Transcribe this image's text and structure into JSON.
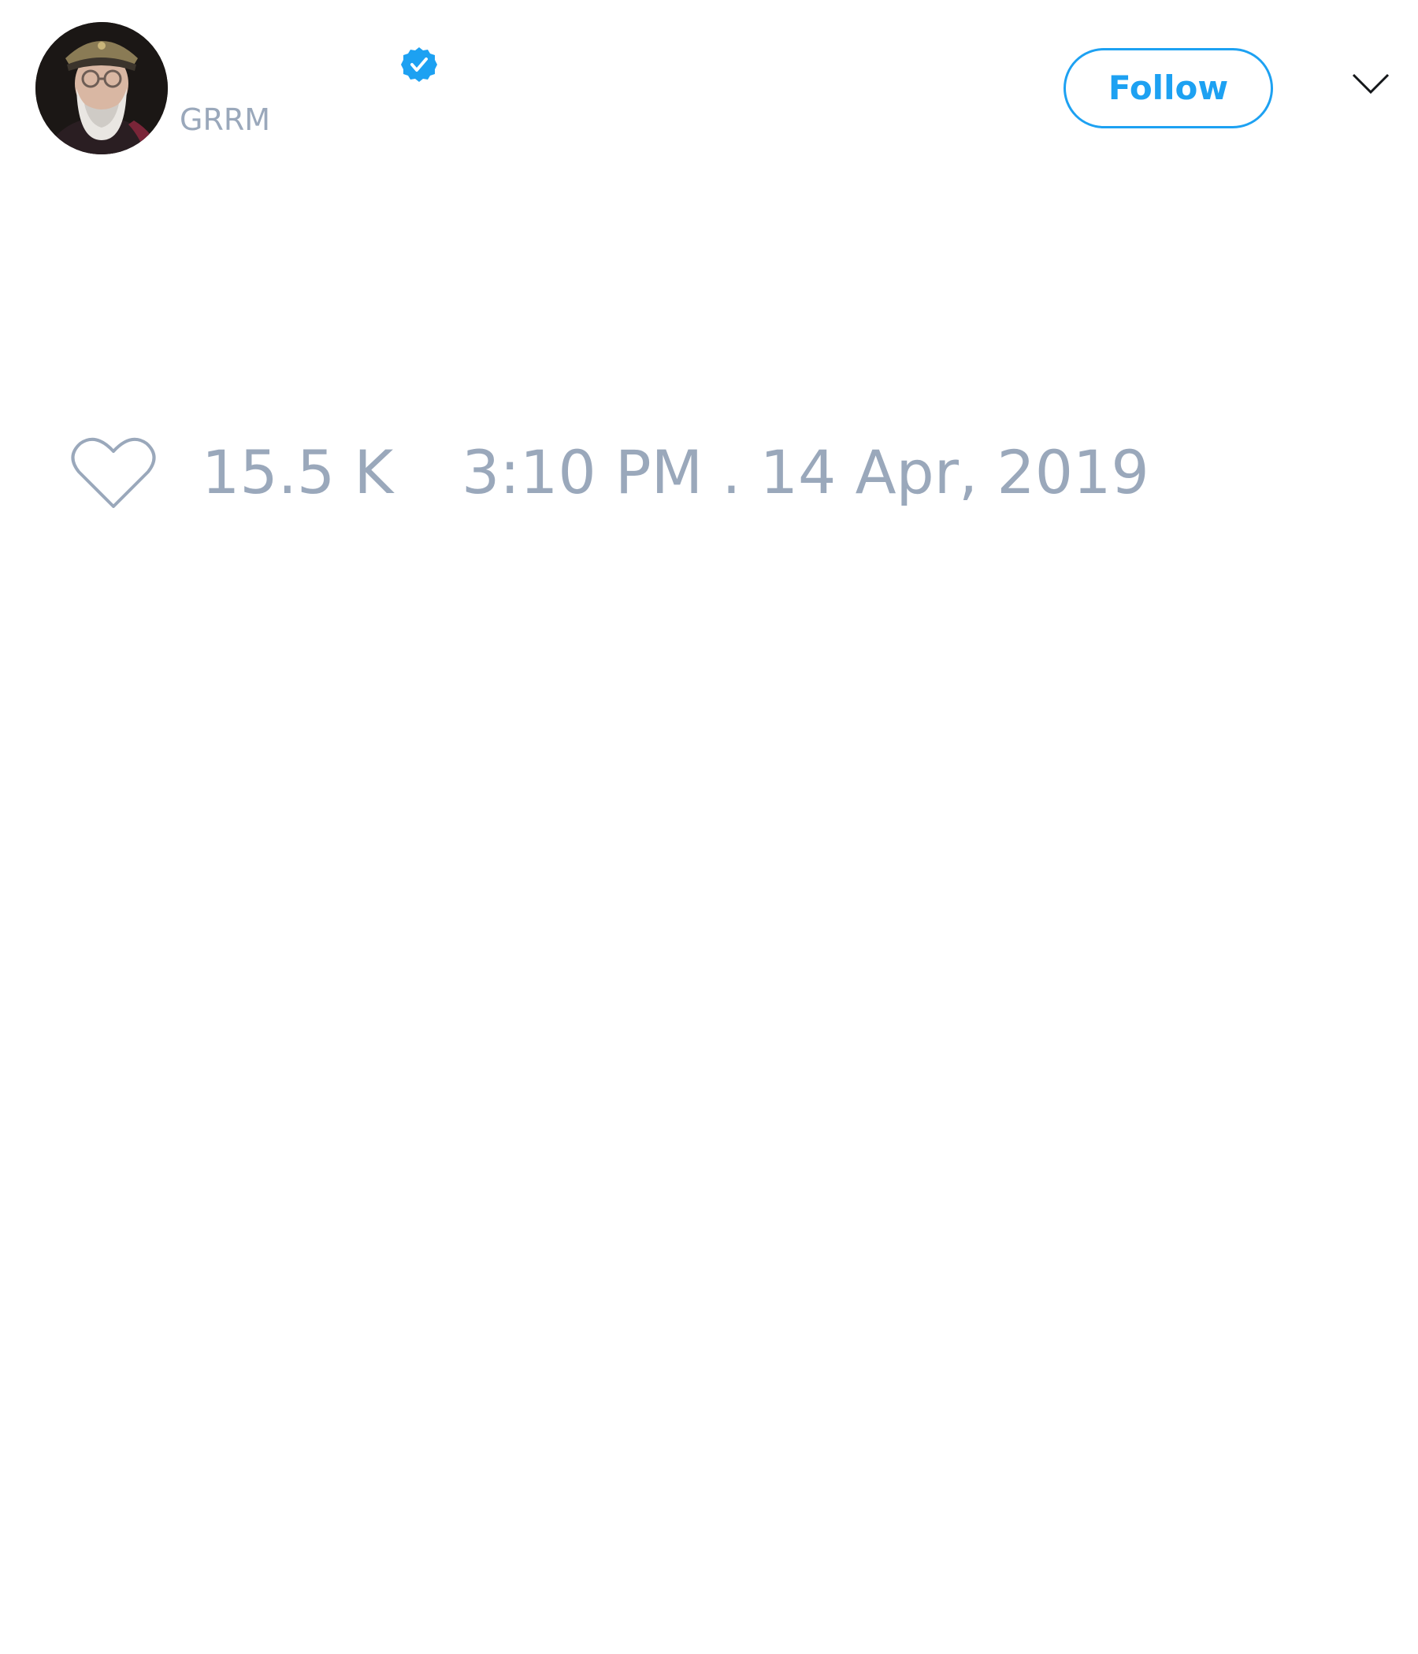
{
  "tweet": {
    "author": {
      "display_name": "",
      "username": "GRRM",
      "verified": true,
      "avatar_icon": "avatar-photo"
    },
    "follow_label": "Follow",
    "menu_icon": "chevron-down-icon",
    "like_icon": "heart-outline-icon",
    "like_count": "15.5 K",
    "timestamp": "3:10 PM . 14 Apr, 2019"
  },
  "colors": {
    "accent": "#1da1f2",
    "muted_text": "#9aa8bb",
    "background": "#ffffff"
  }
}
